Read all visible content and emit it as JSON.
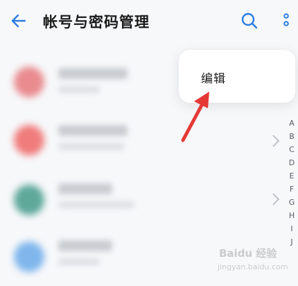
{
  "header": {
    "title": "帐号与密码管理"
  },
  "menu": {
    "edit_label": "编辑"
  },
  "index_letters": [
    "A",
    "B",
    "C",
    "D",
    "E",
    "F",
    "G",
    "H",
    "I",
    "J"
  ],
  "colors": {
    "accent": "#2a7de1",
    "arrow": "#e53935"
  },
  "icons": {
    "back": "back-arrow-icon",
    "search": "search-icon",
    "more": "more-vertical-icon"
  },
  "watermark": {
    "logo": "Baidu 经验",
    "url": "jingyan.baidu.com"
  }
}
